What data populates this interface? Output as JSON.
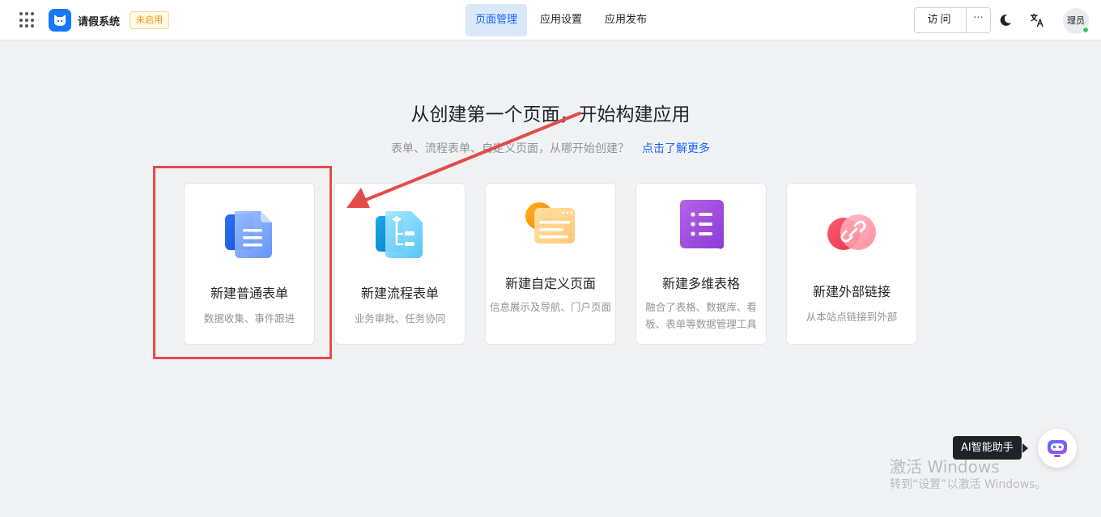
{
  "header": {
    "app_name": "请假系统",
    "status_badge": "未启用",
    "tabs": [
      {
        "label": "页面管理",
        "active": true
      },
      {
        "label": "应用设置",
        "active": false
      },
      {
        "label": "应用发布",
        "active": false
      }
    ],
    "visit_label": "访问",
    "more_label": "···",
    "avatar_text": "理员"
  },
  "main": {
    "title": "从创建第一个页面，开始构建应用",
    "subtitle": "表单、流程表单、自定义页面，从哪开始创建？",
    "learn_more": "点击了解更多",
    "cards": [
      {
        "title": "新建普通表单",
        "desc": "数据收集、事件跟进",
        "icon": "document-form-icon"
      },
      {
        "title": "新建流程表单",
        "desc": "业务审批、任务协同",
        "icon": "flow-form-icon"
      },
      {
        "title": "新建自定义页面",
        "desc": "信息展示及导航、门户页面",
        "icon": "custom-page-icon"
      },
      {
        "title": "新建多维表格",
        "desc": "融合了表格、数据库、看板、表单等数据管理工具",
        "icon": "multi-table-icon"
      },
      {
        "title": "新建外部链接",
        "desc": "从本站点链接到外部",
        "icon": "external-link-icon"
      }
    ]
  },
  "ai_assistant": {
    "tooltip": "AI智能助手"
  },
  "watermark": {
    "line1": "激活 Windows",
    "line2": "转到“设置”以激活 Windows。"
  },
  "colors": {
    "primary": "#1664ff",
    "badge_text": "#fa8c16",
    "annotation_red": "#e44b4b"
  }
}
